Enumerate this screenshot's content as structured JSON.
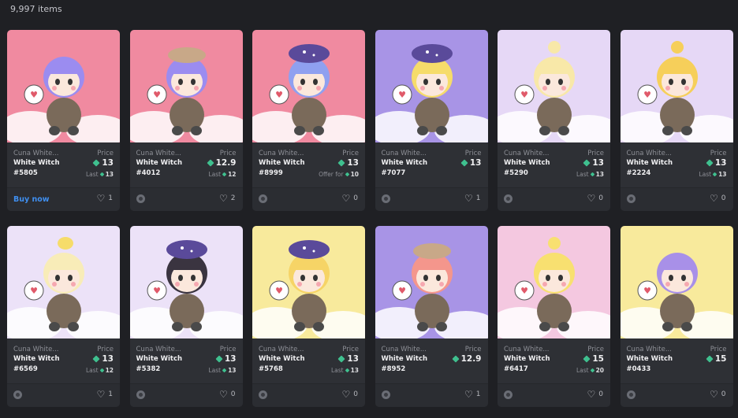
{
  "header": {
    "item_count": "9,997 items"
  },
  "labels": {
    "price": "Price",
    "buy_now": "Buy now",
    "last": "Last",
    "offer_for": "Offer for"
  },
  "accent": {
    "gem": "#3fc08f",
    "link": "#3f8ff0"
  },
  "cards": [
    {
      "collection": "Cuna White...",
      "name": "White Witch",
      "token": "#5805",
      "price": "13",
      "sub_label": "Last",
      "sub_value": "13",
      "buy_now": true,
      "likes": "1",
      "bg": "#f08aa0",
      "hair": "#9b8cf0",
      "hat": "none"
    },
    {
      "collection": "Cuna White...",
      "name": "White Witch",
      "token": "#4012",
      "price": "12.9",
      "sub_label": "Last",
      "sub_value": "12",
      "buy_now": false,
      "likes": "2",
      "bg": "#f08aa0",
      "hair": "#9b8cf0",
      "hat": "cap"
    },
    {
      "collection": "Cuna White...",
      "name": "White Witch",
      "token": "#8999",
      "price": "13",
      "sub_label": "Offer for",
      "sub_value": "10",
      "buy_now": false,
      "likes": "0",
      "bg": "#f08aa0",
      "hair": "#8fa0f0",
      "hat": "witch"
    },
    {
      "collection": "Cuna White...",
      "name": "White Witch",
      "token": "#7077",
      "price": "13",
      "sub_label": "",
      "sub_value": "",
      "buy_now": false,
      "likes": "1",
      "bg": "#a894e6",
      "hair": "#f6dc6a",
      "hat": "witch"
    },
    {
      "collection": "Cuna White...",
      "name": "White Witch",
      "token": "#5290",
      "price": "13",
      "sub_label": "Last",
      "sub_value": "13",
      "buy_now": false,
      "likes": "0",
      "bg": "#e6d8f6",
      "hair": "#f8e8a8",
      "hat": "bun"
    },
    {
      "collection": "Cuna White...",
      "name": "White Witch",
      "token": "#2224",
      "price": "13",
      "sub_label": "Last",
      "sub_value": "13",
      "buy_now": false,
      "likes": "0",
      "bg": "#e6d8f6",
      "hair": "#f6cf5a",
      "hat": "bun"
    },
    {
      "collection": "Cuna White...",
      "name": "White Witch",
      "token": "#6569",
      "price": "13",
      "sub_label": "Last",
      "sub_value": "12",
      "buy_now": false,
      "likes": "1",
      "bg": "#ece2f8",
      "hair": "#f8ecb8",
      "hat": "duck"
    },
    {
      "collection": "Cuna White...",
      "name": "White Witch",
      "token": "#5382",
      "price": "13",
      "sub_label": "Last",
      "sub_value": "13",
      "buy_now": false,
      "likes": "0",
      "bg": "#ece2f8",
      "hair": "#3a3440",
      "hat": "witch"
    },
    {
      "collection": "Cuna White...",
      "name": "White Witch",
      "token": "#5768",
      "price": "13",
      "sub_label": "Last",
      "sub_value": "13",
      "buy_now": false,
      "likes": "0",
      "bg": "#f8ea9c",
      "hair": "#f6d466",
      "hat": "witch"
    },
    {
      "collection": "Cuna White...",
      "name": "White Witch",
      "token": "#8952",
      "price": "12.9",
      "sub_label": "",
      "sub_value": "",
      "buy_now": false,
      "likes": "1",
      "bg": "#a894e6",
      "hair": "#f4968c",
      "hat": "cap"
    },
    {
      "collection": "Cuna White...",
      "name": "White Witch",
      "token": "#6417",
      "price": "15",
      "sub_label": "Last",
      "sub_value": "20",
      "buy_now": false,
      "likes": "0",
      "bg": "#f4c8e0",
      "hair": "#f8e070",
      "hat": "bun"
    },
    {
      "collection": "Cuna White...",
      "name": "White Witch",
      "token": "#0433",
      "price": "15",
      "sub_label": "",
      "sub_value": "",
      "buy_now": false,
      "likes": "0",
      "bg": "#f8ea9c",
      "hair": "#a890e8",
      "hat": "none"
    }
  ]
}
